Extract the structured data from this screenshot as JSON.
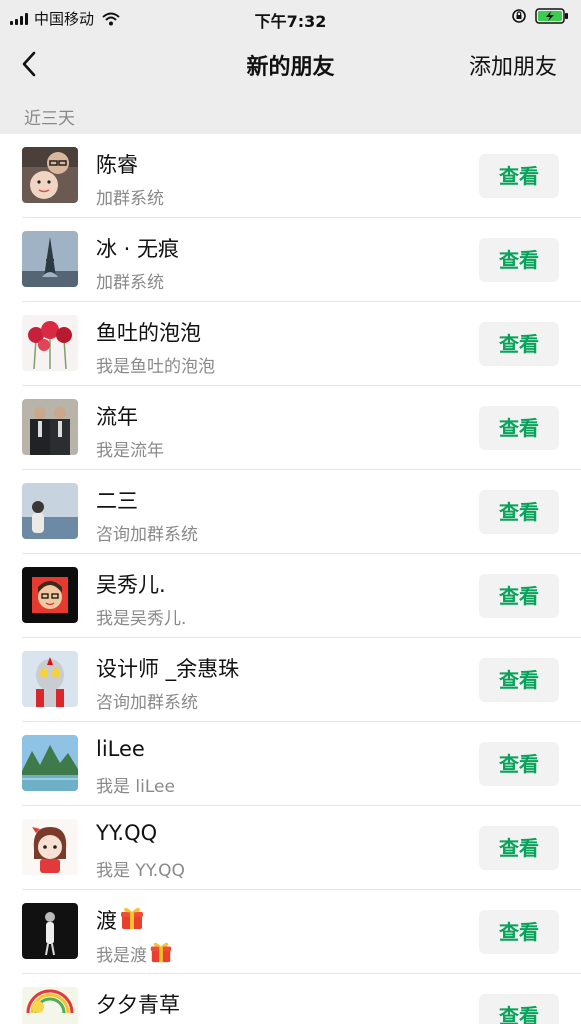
{
  "status_bar": {
    "carrier": "中国移动",
    "time": "下午7:32"
  },
  "nav": {
    "title": "新的朋友",
    "add_label": "添加朋友"
  },
  "section": {
    "label": "近三天"
  },
  "requests": [
    {
      "name": "陈睿",
      "message": "加群系统",
      "action": "查看"
    },
    {
      "name": "冰 · 无痕",
      "message": "加群系统",
      "action": "查看"
    },
    {
      "name": "鱼吐的泡泡",
      "message": "我是鱼吐的泡泡",
      "action": "查看"
    },
    {
      "name": "流年",
      "message": "我是流年",
      "action": "查看"
    },
    {
      "name": "二三",
      "message": "咨询加群系统",
      "action": "查看"
    },
    {
      "name": "吴秀儿.",
      "message": "我是吴秀儿.",
      "action": "查看"
    },
    {
      "name": "设计师 _余惠珠",
      "message": "咨询加群系统",
      "action": "查看"
    },
    {
      "name": "liLee",
      "message": "我是 liLee",
      "action": "查看"
    },
    {
      "name": "YY.QQ",
      "message": "我是 YY.QQ",
      "action": "查看"
    },
    {
      "name": "渡",
      "message": "我是渡",
      "action": "查看"
    },
    {
      "name": "夕夕青草",
      "message": "",
      "action": "查看"
    }
  ],
  "colors": {
    "accent": "#07a35a",
    "background": "#ededed",
    "button_bg": "#f2f2f2"
  }
}
